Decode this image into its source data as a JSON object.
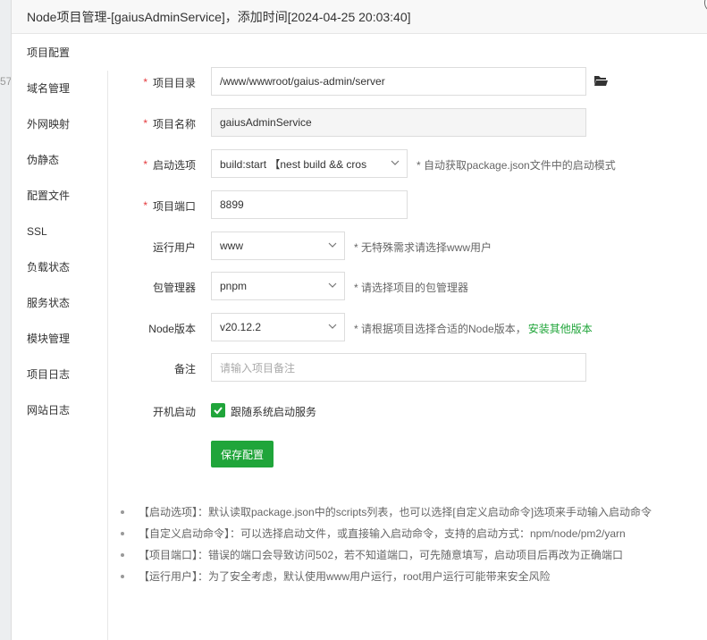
{
  "background": {
    "peek_text": "57"
  },
  "dialog": {
    "title": "Node项目管理-[gaiusAdminService]，添加时间[2024-04-25 20:03:40]",
    "close_icon": "close-icon"
  },
  "sidebar": {
    "items": [
      {
        "label": "项目配置"
      },
      {
        "label": "域名管理"
      },
      {
        "label": "外网映射"
      },
      {
        "label": "伪静态"
      },
      {
        "label": "配置文件"
      },
      {
        "label": "SSL"
      },
      {
        "label": "负载状态"
      },
      {
        "label": "服务状态"
      },
      {
        "label": "模块管理"
      },
      {
        "label": "项目日志"
      },
      {
        "label": "网站日志"
      }
    ],
    "active_index": 0
  },
  "form": {
    "required_mark": "*",
    "project_dir": {
      "label": "项目目录",
      "value": "/www/wwwroot/gaius-admin/server",
      "icon": "folder-icon"
    },
    "project_name": {
      "label": "项目名称",
      "value": "gaiusAdminService"
    },
    "start_option": {
      "label": "启动选项",
      "value": "build:start 【nest build && cros",
      "hint": "* 自动获取package.json文件中的启动模式"
    },
    "project_port": {
      "label": "项目端口",
      "value": "8899"
    },
    "run_user": {
      "label": "运行用户",
      "value": "www",
      "hint": "* 无特殊需求请选择www用户"
    },
    "package_manager": {
      "label": "包管理器",
      "value": "pnpm",
      "hint": "* 请选择项目的包管理器"
    },
    "node_version": {
      "label": "Node版本",
      "value": "v20.12.2",
      "hint": "* 请根据项目选择合适的Node版本，",
      "link": "安装其他版本"
    },
    "remark": {
      "label": "备注",
      "placeholder": "请输入项目备注"
    },
    "autostart": {
      "label": "开机启动",
      "checkbox_label": "跟随系统启动服务",
      "checked": true
    },
    "save_label": "保存配置"
  },
  "notes": [
    "【启动选项】：默认读取package.json中的scripts列表，也可以选择[自定义启动命令]选项来手动输入启动命令",
    "【自定义启动命令】：可以选择启动文件，或直接输入启动命令，支持的启动方式：npm/node/pm2/yarn",
    "【项目端口】：错误的端口会导致访问502，若不知道端口，可先随意填写，启动项目后再改为正确端口",
    "【运行用户】：为了安全考虑，默认使用www用户运行，root用户运行可能带来安全风险"
  ],
  "colors": {
    "accent": "#20a53a",
    "required": "#e4393c"
  }
}
